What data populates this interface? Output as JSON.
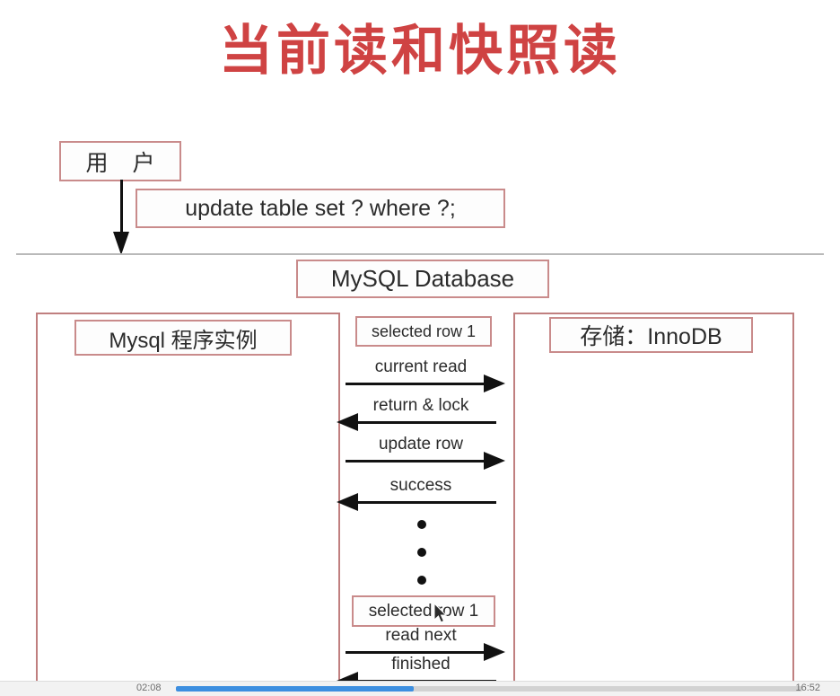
{
  "slide": {
    "title": "当前读和快照读",
    "title_color": "#cf4343",
    "box_border_color": "#c98b8b",
    "panel_border_color": "#c07f7f",
    "arrow_color": "#111111",
    "separator_color": "#b9b9b9"
  },
  "top": {
    "user_box": "用 户",
    "sql_box": "update table set ?  where  ?;",
    "database_box": "MySQL   Database"
  },
  "panels": {
    "left": {
      "label": "Mysql 程序实例"
    },
    "right": {
      "label": "存储：InnoDB"
    }
  },
  "messages": {
    "selected_row_top": "selected  row 1",
    "selected_row_bottom": "selected  row 1",
    "current_read": "current read",
    "return_lock": "return  &  lock",
    "update_row": "update  row",
    "success": "success",
    "read_next": "read   next",
    "finished": "finished",
    "ellipsis": "⋮"
  },
  "player": {
    "current_time": "02:08",
    "total_time": "16:52",
    "progress_percent": 38,
    "accent_color": "#3d8fe0"
  }
}
